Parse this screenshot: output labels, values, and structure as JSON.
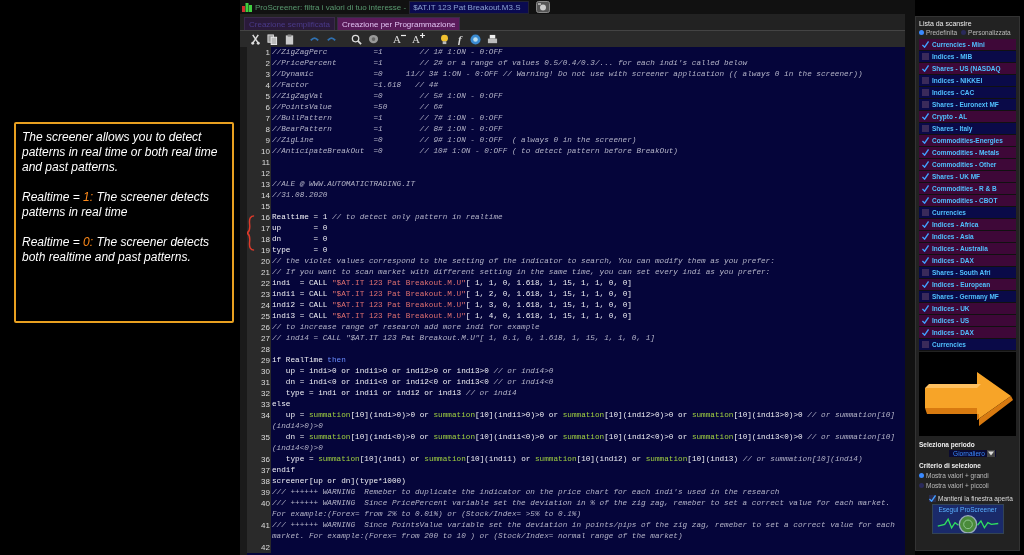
{
  "titlebar": {
    "title": "ProScreener: filtra i valori di tuo interesse -",
    "file": "$AT.IT 123 Pat Breakout.M3.S"
  },
  "tabs": [
    {
      "label": "Creazione semplificata",
      "selected": false
    },
    {
      "label": "Creazione per Programmazione",
      "selected": true
    }
  ],
  "toolbar": [
    {
      "kind": "cut"
    },
    {
      "kind": "copy"
    },
    {
      "kind": "paste"
    },
    {
      "kind": "undo"
    },
    {
      "kind": "redo"
    },
    {
      "kind": "search"
    },
    {
      "kind": "comment"
    },
    {
      "kind": "font-smaller",
      "label": "A"
    },
    {
      "kind": "font-larger",
      "label": "A"
    },
    {
      "kind": "bulb"
    },
    {
      "kind": "function",
      "label": "f"
    },
    {
      "kind": "help"
    },
    {
      "kind": "print"
    }
  ],
  "editor": {
    "lines": [
      {
        "n": "1",
        "segments": [
          {
            "kind": "comment",
            "text": "//ZigZagPerc          =1        // 1# 1:ON - 0:OFF"
          }
        ]
      },
      {
        "n": "2",
        "segments": [
          {
            "kind": "comment",
            "text": "//PricePercent        =1        // 2# or a range of values 0.5/0.4/0.3/... for each indi's called below"
          }
        ]
      },
      {
        "n": "3",
        "segments": [
          {
            "kind": "comment",
            "text": "//Dynamic             =0     11// 3# 1:ON - 0:OFF // Warning! Do not use with screener application (( always 0 in the screener))"
          }
        ]
      },
      {
        "n": "4",
        "segments": [
          {
            "kind": "comment",
            "text": "//Factor              =1.618   // 4#"
          }
        ]
      },
      {
        "n": "5",
        "segments": [
          {
            "kind": "comment",
            "text": "//ZigZagVal           =0        // 5# 1:ON - 0:OFF"
          }
        ]
      },
      {
        "n": "6",
        "segments": [
          {
            "kind": "comment",
            "text": "//PointsValue         =50       // 6#"
          }
        ]
      },
      {
        "n": "7",
        "segments": [
          {
            "kind": "comment",
            "text": "//BullPattern         =1        // 7# 1:ON - 0:OFF"
          }
        ]
      },
      {
        "n": "8",
        "segments": [
          {
            "kind": "comment",
            "text": "//BearPattern         =1        // 8# 1:ON - 0:OFF"
          }
        ]
      },
      {
        "n": "9",
        "segments": [
          {
            "kind": "comment",
            "text": "//ZigLine             =0        // 9# 1:ON - 0:OFF  ( always 0 in the screener)"
          }
        ]
      },
      {
        "n": "10",
        "segments": [
          {
            "kind": "comment",
            "text": "//AnticipateBreakOut  =0        // 10# 1:ON - 0:OFF ( to detect pattern before BreakOut)"
          }
        ]
      },
      {
        "n": "11"
      },
      {
        "n": "12"
      },
      {
        "n": "13",
        "segments": [
          {
            "kind": "comment",
            "text": "//ALE @ WWW.AUTOMATICTRADING.IT"
          }
        ]
      },
      {
        "n": "14",
        "segments": [
          {
            "kind": "comment",
            "text": "//31.08.2020"
          }
        ]
      },
      {
        "n": "15"
      },
      {
        "n": "16",
        "segments": [
          {
            "kind": "plain",
            "text": "Realtime = 1 "
          },
          {
            "kind": "comment",
            "text": "// to detect only pattern in realtime"
          }
        ]
      },
      {
        "n": "17",
        "segments": [
          {
            "kind": "plain",
            "text": "up       = 0"
          }
        ]
      },
      {
        "n": "18",
        "segments": [
          {
            "kind": "plain",
            "text": "dn       = 0"
          }
        ]
      },
      {
        "n": "19",
        "segments": [
          {
            "kind": "plain",
            "text": "type     = 0"
          }
        ]
      },
      {
        "n": "20",
        "segments": [
          {
            "kind": "comment",
            "text": "// the violet values correspond to the setting of the indicator to search, You can modify them as you prefer:"
          }
        ]
      },
      {
        "n": "21",
        "segments": [
          {
            "kind": "comment",
            "text": "// If you want to scan market with different setting in the same time, you can set every indi as you prefer:"
          }
        ]
      },
      {
        "n": "22",
        "segments": [
          {
            "kind": "plain",
            "text": "indi  = CALL "
          },
          {
            "kind": "string",
            "text": "\"$AT.IT 123 Pat Breakout.M.U\""
          },
          {
            "kind": "plain",
            "text": "[ 1, 1, 0, 1.618, 1, 15, 1, 1, 0, 0]"
          }
        ]
      },
      {
        "n": "23",
        "segments": [
          {
            "kind": "plain",
            "text": "indi1 = CALL "
          },
          {
            "kind": "string",
            "text": "\"$AT.IT 123 Pat Breakout.M.U\""
          },
          {
            "kind": "plain",
            "text": "[ 1, 2, 0, 1.618, 1, 15, 1, 1, 0, 0]"
          }
        ]
      },
      {
        "n": "24",
        "segments": [
          {
            "kind": "plain",
            "text": "indi2 = CALL "
          },
          {
            "kind": "string",
            "text": "\"$AT.IT 123 Pat Breakout.M.U\""
          },
          {
            "kind": "plain",
            "text": "[ 1, 3, 0, 1.618, 1, 15, 1, 1, 0, 0]"
          }
        ]
      },
      {
        "n": "25",
        "segments": [
          {
            "kind": "plain",
            "text": "indi3 = CALL "
          },
          {
            "kind": "string",
            "text": "\"$AT.IT 123 Pat Breakout.M.U\""
          },
          {
            "kind": "plain",
            "text": "[ 1, 4, 0, 1.618, 1, 15, 1, 1, 0, 0]"
          }
        ]
      },
      {
        "n": "26",
        "segments": [
          {
            "kind": "comment",
            "text": "// to increase range of research add more indi for example"
          }
        ]
      },
      {
        "n": "27",
        "segments": [
          {
            "kind": "comment",
            "text": "// indi4 = CALL \"$AT.IT 123 Pat Breakout.M.U\"[ 1, 0.1, 0, 1.618, 1, 15, 1, 1, 0, 1]"
          }
        ]
      },
      {
        "n": "28"
      },
      {
        "n": "29",
        "segments": [
          {
            "kind": "plain",
            "text": "if RealTime "
          },
          {
            "kind": "keyword",
            "text": "then"
          }
        ]
      },
      {
        "n": "30",
        "segments": [
          {
            "kind": "plain",
            "text": "   up = indi>0 or indi1>0 or indi2>0 or indi3>0 "
          },
          {
            "kind": "comment",
            "text": "// or indi4>0"
          }
        ]
      },
      {
        "n": "31",
        "segments": [
          {
            "kind": "plain",
            "text": "   dn = indi<0 or indi1<0 or indi2<0 or indi3<0 "
          },
          {
            "kind": "comment",
            "text": "// or indi4<0"
          }
        ]
      },
      {
        "n": "32",
        "segments": [
          {
            "kind": "plain",
            "text": "   type = indi or indi1 or indi2 or indi3 "
          },
          {
            "kind": "comment",
            "text": "// or indi4"
          }
        ]
      },
      {
        "n": "33",
        "segments": [
          {
            "kind": "plain",
            "text": "else"
          }
        ]
      },
      {
        "n": "34",
        "segments": [
          {
            "kind": "plain",
            "text": "   up = "
          },
          {
            "kind": "function",
            "text": "summation"
          },
          {
            "kind": "plain",
            "text": "[10](indi>0)>0 or "
          },
          {
            "kind": "function",
            "text": "summation"
          },
          {
            "kind": "plain",
            "text": "[10](indi1>0)>0 or "
          },
          {
            "kind": "function",
            "text": "summation"
          },
          {
            "kind": "plain",
            "text": "[10](indi2>0)>0 or "
          },
          {
            "kind": "function",
            "text": "summation"
          },
          {
            "kind": "plain",
            "text": "[10](indi3>0)>0 "
          },
          {
            "kind": "comment",
            "text": "// or summation[10](indi4>0)>0"
          }
        ]
      },
      {
        "n": "35",
        "segments": [
          {
            "kind": "plain",
            "text": "   dn = "
          },
          {
            "kind": "function",
            "text": "summation"
          },
          {
            "kind": "plain",
            "text": "[10](indi<0)>0 or "
          },
          {
            "kind": "function",
            "text": "summation"
          },
          {
            "kind": "plain",
            "text": "[10](indi1<0)>0 or "
          },
          {
            "kind": "function",
            "text": "summation"
          },
          {
            "kind": "plain",
            "text": "[10](indi2<0)>0 or "
          },
          {
            "kind": "function",
            "text": "summation"
          },
          {
            "kind": "plain",
            "text": "[10](indi3<0)>0 "
          },
          {
            "kind": "comment",
            "text": "// or summation[10](indi4<0)>0"
          }
        ]
      },
      {
        "n": "36",
        "segments": [
          {
            "kind": "plain",
            "text": "   type = "
          },
          {
            "kind": "function",
            "text": "summation"
          },
          {
            "kind": "plain",
            "text": "[10](indi) or "
          },
          {
            "kind": "function",
            "text": "summation"
          },
          {
            "kind": "plain",
            "text": "[10](indi1) or "
          },
          {
            "kind": "function",
            "text": "summation"
          },
          {
            "kind": "plain",
            "text": "[10](indi2) or "
          },
          {
            "kind": "function",
            "text": "summation"
          },
          {
            "kind": "plain",
            "text": "[10](indi3) "
          },
          {
            "kind": "comment",
            "text": "// or summation[10](indi4)"
          }
        ]
      },
      {
        "n": "37",
        "segments": [
          {
            "kind": "plain",
            "text": "endif"
          }
        ]
      },
      {
        "n": "38",
        "segments": [
          {
            "kind": "plain",
            "text": "screener[up or dn](type*1000)"
          }
        ]
      },
      {
        "n": "39",
        "segments": [
          {
            "kind": "comment",
            "text": "/// ++++++ WARNING  Remeber to duplicate the indicator on the price chart for each indi's used in the research"
          }
        ]
      },
      {
        "n": "40",
        "segments": [
          {
            "kind": "comment",
            "text": "/// ++++++ WARNING  Since PricePercent variable set the deviation in % of the zig zag, remeber to set a correct value for each market. For example:(Forex= from 2% to 0.01%) or (Stock/Index= >5% to 0.1%)"
          }
        ]
      },
      {
        "n": "41",
        "segments": [
          {
            "kind": "comment",
            "text": "/// ++++++ WARNING  Since PointsValue variable set the deviation in points/pips of the zig zag, remeber to set a correct value for each market. For example:(Forex= from 200 to 10 ) or (Stock/Index= normal range of the market)"
          }
        ]
      },
      {
        "n": "42"
      }
    ]
  },
  "callout": {
    "paragraphs": [
      [
        {
          "text": "The screener allows you to detect patterns in real time or both real time and past patterns.",
          "highlight": false
        }
      ],
      [
        {
          "text": "Realtime = ",
          "highlight": false
        },
        {
          "text": "1:",
          "highlight": true
        },
        {
          "text": " The screener detects patterns in real time",
          "highlight": false
        }
      ],
      [
        {
          "text": "Realtime = ",
          "highlight": false
        },
        {
          "text": "0:",
          "highlight": true
        },
        {
          "text": " The screener detects both realtime and past patterns.",
          "highlight": false
        }
      ]
    ]
  },
  "sidebar": {
    "list_title": "Lista da scansire",
    "list_modes": [
      {
        "label": "Predefinita",
        "selected": true
      },
      {
        "label": "Personalizzata",
        "selected": false
      }
    ],
    "lists": [
      {
        "label": "Currencies - Mini",
        "checked": true
      },
      {
        "label": "Indices - MIB",
        "checked": false
      },
      {
        "label": "Shares - US (NASDAQ",
        "checked": true
      },
      {
        "label": "Indices - NIKKEI",
        "checked": false
      },
      {
        "label": "Indices - CAC",
        "checked": false
      },
      {
        "label": "Shares - Euronext MF",
        "checked": false
      },
      {
        "label": "Crypto - AL",
        "checked": true
      },
      {
        "label": "Shares - Italy",
        "checked": false
      },
      {
        "label": "Commodities-Energies",
        "checked": true
      },
      {
        "label": "Commodities - Metals",
        "checked": true
      },
      {
        "label": "Commodities - Other",
        "checked": true
      },
      {
        "label": "Shares - UK MF",
        "checked": true
      },
      {
        "label": "Commodities - R & B",
        "checked": true
      },
      {
        "label": "Commodities - CBOT",
        "checked": true
      },
      {
        "label": "Currencies",
        "checked": false
      },
      {
        "label": "Indices - Africa",
        "checked": true
      },
      {
        "label": "Indices - Asia",
        "checked": true
      },
      {
        "label": "Indices - Australia",
        "checked": true
      },
      {
        "label": "Indices - DAX",
        "checked": true
      },
      {
        "label": "Shares - South Afri",
        "checked": false
      },
      {
        "label": "Indices - European",
        "checked": true
      },
      {
        "label": "Shares - Germany MF",
        "checked": false
      },
      {
        "label": "Indices - UK",
        "checked": true
      },
      {
        "label": "Indices - US",
        "checked": true
      },
      {
        "label": "Indices - DAX",
        "checked": true
      },
      {
        "label": "Currencies",
        "checked": false
      }
    ],
    "period_title": "Seleziona periodo",
    "period": "Giornaliero",
    "criteria_title": "Criterio di selezione",
    "criteria": [
      {
        "label": "Mostra valori + grandi",
        "selected": true
      },
      {
        "label": "Mostra valori + piccoli",
        "selected": false
      }
    ],
    "keep_open": {
      "label": "Mantieni la finestra aperta",
      "checked": true
    },
    "run_button": "Esegui ProScreener"
  }
}
